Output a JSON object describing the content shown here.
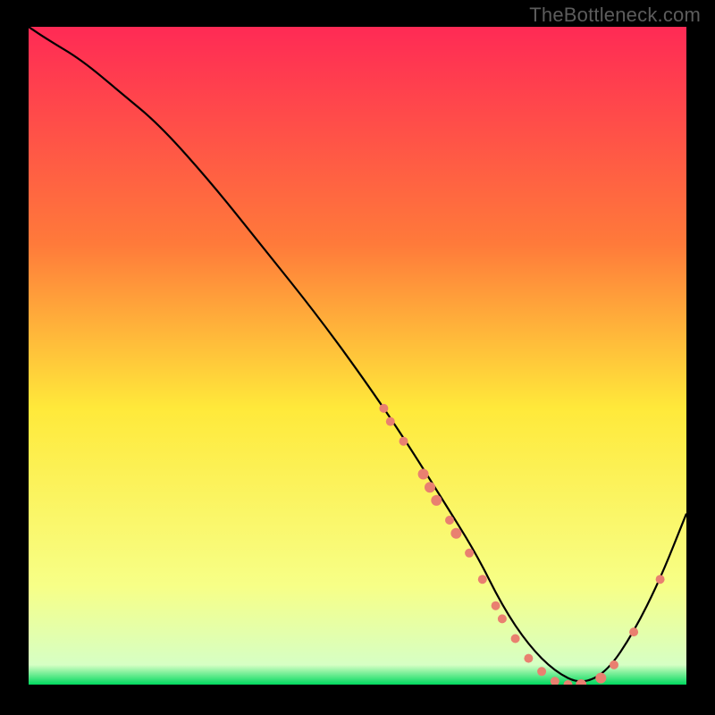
{
  "watermark": "TheBottleneck.com",
  "chart_data": {
    "type": "line",
    "title": "",
    "xlabel": "",
    "ylabel": "",
    "xlim": [
      0,
      100
    ],
    "ylim": [
      0,
      100
    ],
    "grid": false,
    "legend": false,
    "background_gradient": {
      "top": "#ff2a55",
      "mid_upper": "#ff7a3a",
      "mid": "#ffe93a",
      "mid_lower": "#f7ff87",
      "bottom": "#00d95f"
    },
    "series": [
      {
        "name": "bottleneck-curve",
        "color": "#000000",
        "x": [
          0,
          3,
          8,
          14,
          20,
          28,
          36,
          44,
          52,
          58,
          63,
          68,
          72,
          76,
          80,
          84,
          88,
          92,
          96,
          100
        ],
        "y": [
          100,
          98,
          95,
          90,
          85,
          76,
          66,
          56,
          45,
          36,
          28,
          20,
          12,
          6,
          2,
          0,
          2,
          8,
          16,
          26
        ]
      }
    ],
    "scatter_points": {
      "name": "data-points",
      "color": "#e98070",
      "points": [
        {
          "x": 54,
          "y": 42,
          "r": 5
        },
        {
          "x": 55,
          "y": 40,
          "r": 5
        },
        {
          "x": 57,
          "y": 37,
          "r": 5
        },
        {
          "x": 60,
          "y": 32,
          "r": 6
        },
        {
          "x": 61,
          "y": 30,
          "r": 6
        },
        {
          "x": 62,
          "y": 28,
          "r": 6
        },
        {
          "x": 64,
          "y": 25,
          "r": 5
        },
        {
          "x": 65,
          "y": 23,
          "r": 6
        },
        {
          "x": 67,
          "y": 20,
          "r": 5
        },
        {
          "x": 69,
          "y": 16,
          "r": 5
        },
        {
          "x": 71,
          "y": 12,
          "r": 5
        },
        {
          "x": 72,
          "y": 10,
          "r": 5
        },
        {
          "x": 74,
          "y": 7,
          "r": 5
        },
        {
          "x": 76,
          "y": 4,
          "r": 5
        },
        {
          "x": 78,
          "y": 2,
          "r": 5
        },
        {
          "x": 80,
          "y": 0.5,
          "r": 5
        },
        {
          "x": 82,
          "y": 0,
          "r": 5
        },
        {
          "x": 84,
          "y": 0,
          "r": 6
        },
        {
          "x": 87,
          "y": 1,
          "r": 6
        },
        {
          "x": 89,
          "y": 3,
          "r": 5
        },
        {
          "x": 92,
          "y": 8,
          "r": 5
        },
        {
          "x": 96,
          "y": 16,
          "r": 5
        }
      ]
    }
  }
}
